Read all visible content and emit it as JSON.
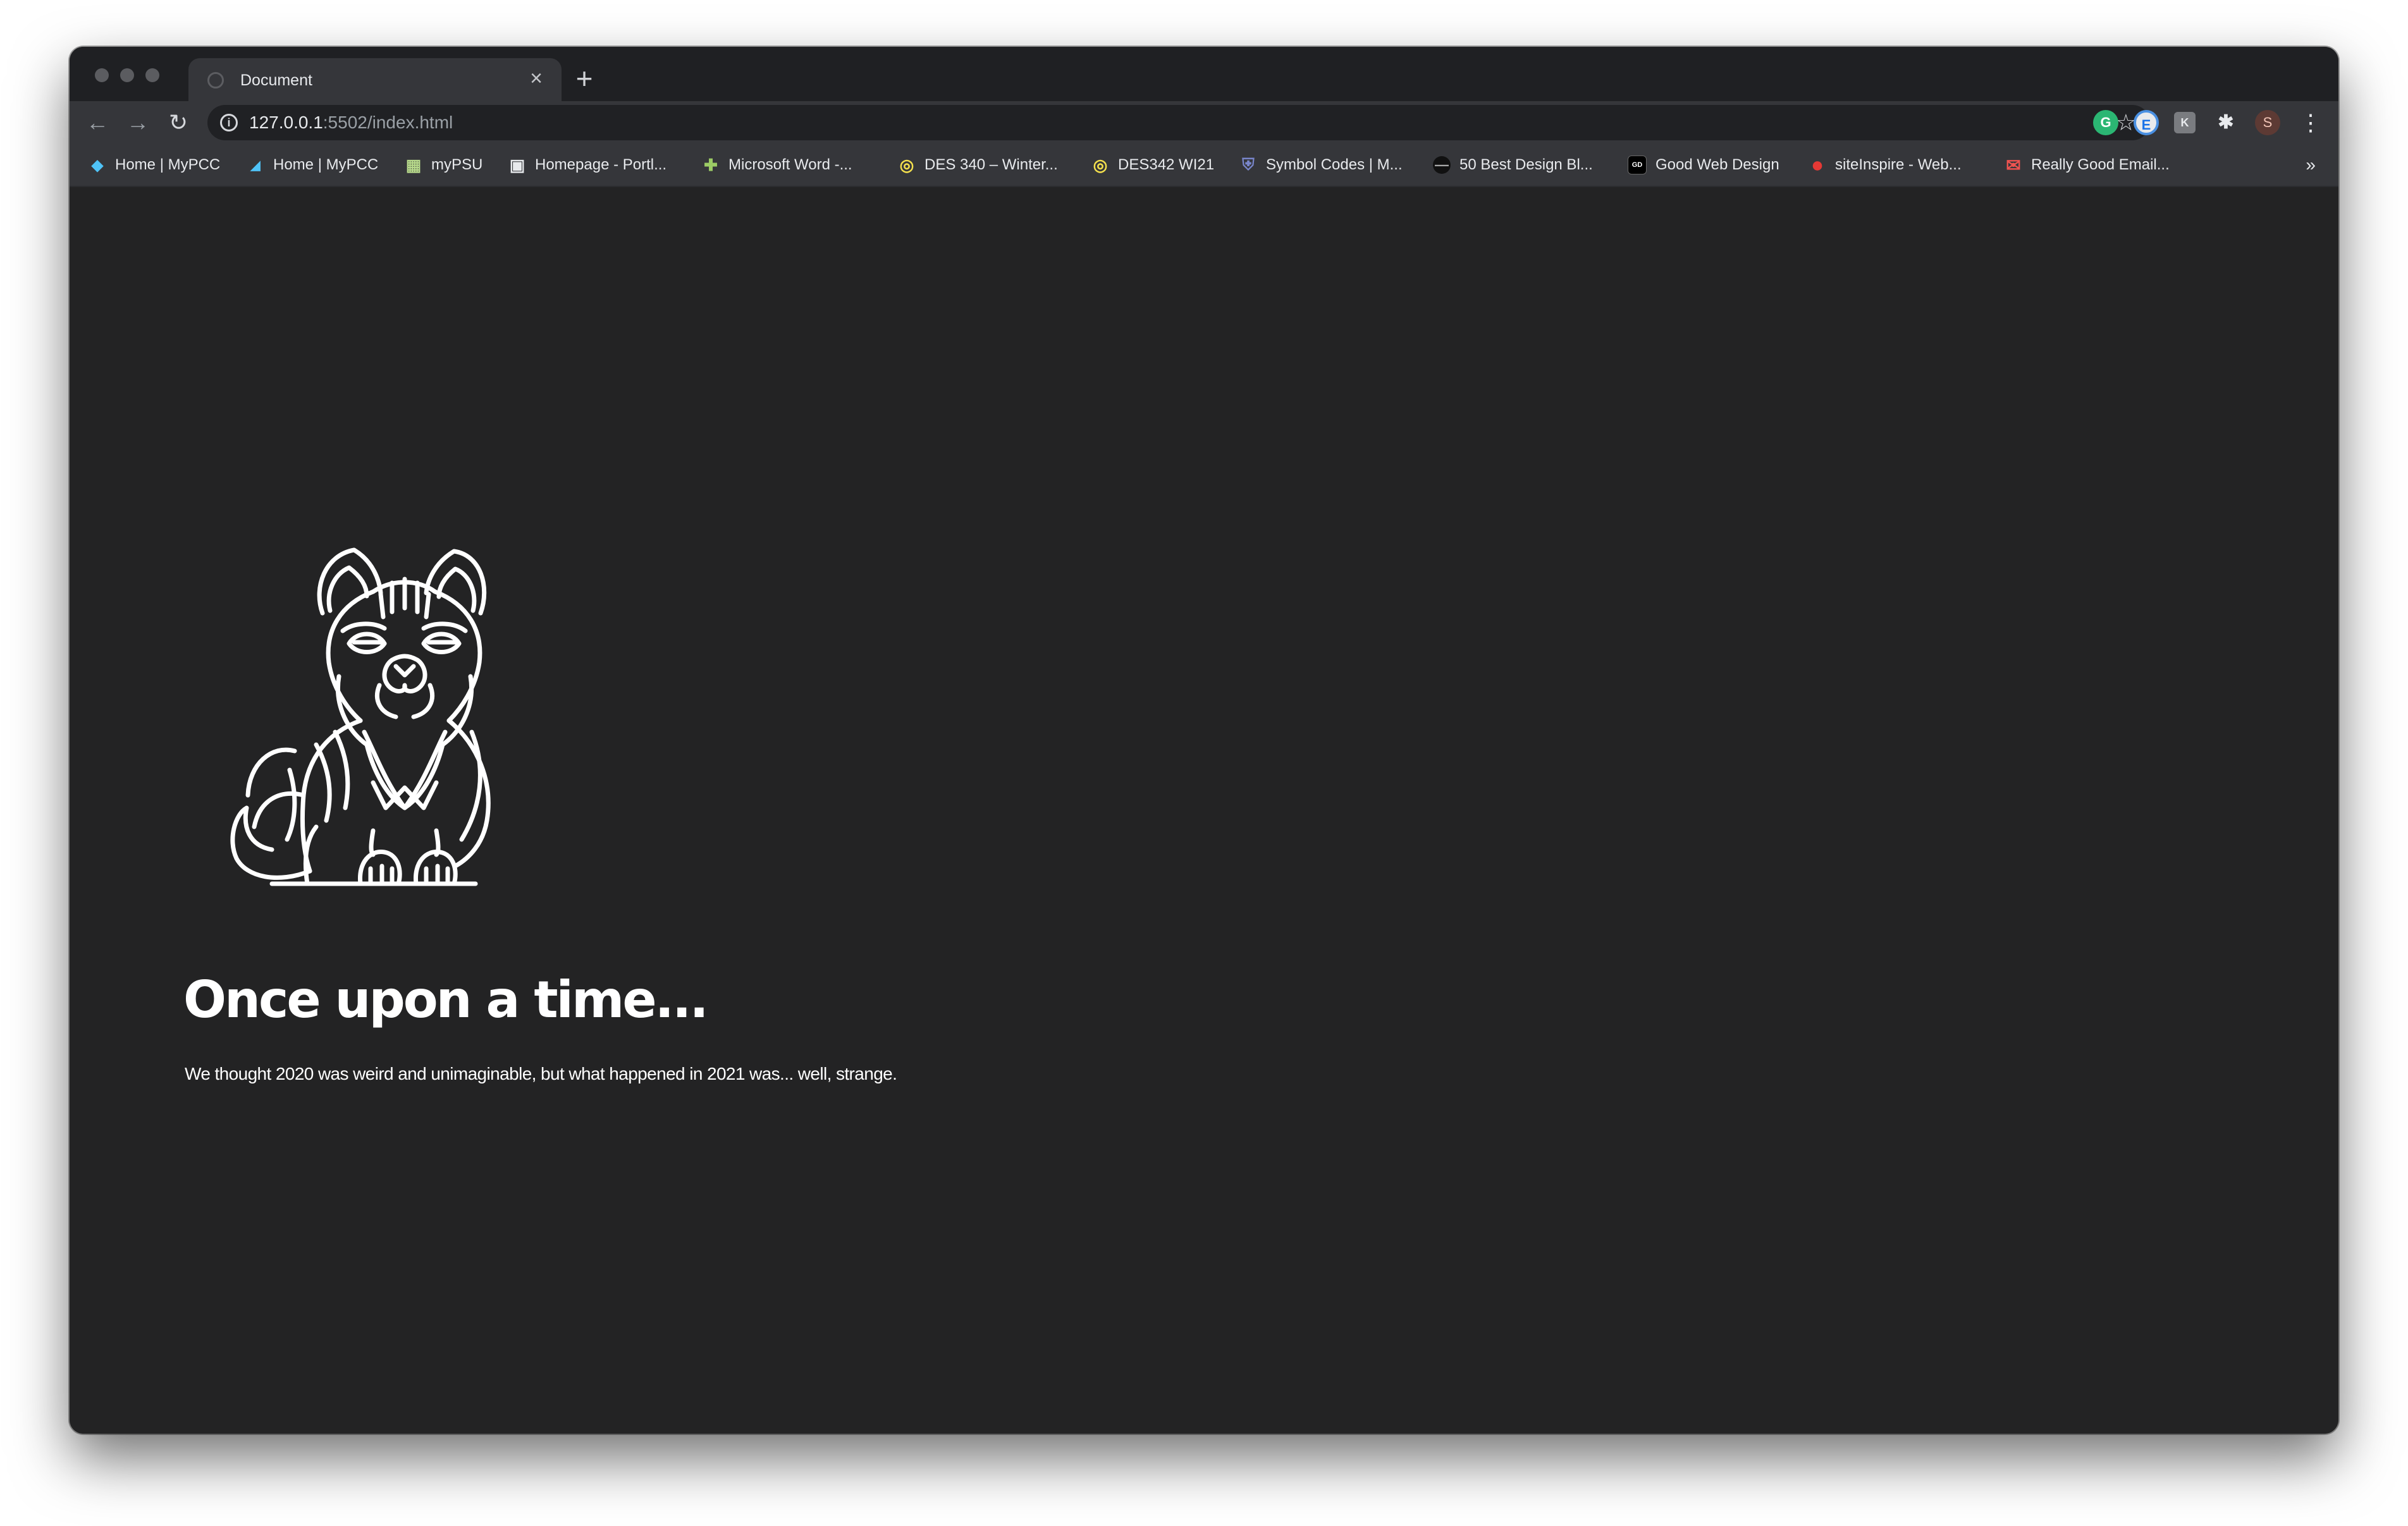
{
  "browser": {
    "tab": {
      "title": "Document",
      "close_glyph": "×"
    },
    "new_tab_glyph": "+",
    "toolbar": {
      "back_glyph": "←",
      "forward_glyph": "→",
      "reload_glyph": "↻",
      "url_host": "127.0.0.1",
      "url_rest": ":5502/index.html",
      "star_glyph": "☆",
      "extensions": [
        {
          "name": "grammarly-icon",
          "glyph": "G"
        },
        {
          "name": "extension-e-icon",
          "glyph": "E"
        },
        {
          "name": "extension-k-icon",
          "glyph": "K"
        },
        {
          "name": "puzzle-icon",
          "glyph": "✱"
        },
        {
          "name": "profile-avatar",
          "glyph": "S"
        }
      ],
      "menu_glyph": "⋮"
    },
    "bookmarks": [
      {
        "label": "Home | MyPCC",
        "icon": "mypcc-diamond-icon",
        "glyph": "◆",
        "color": "#4fc3f7"
      },
      {
        "label": "Home | MyPCC",
        "icon": "mypcc-flag-icon",
        "glyph": "◢",
        "color": "#4fc3f7"
      },
      {
        "label": "myPSU",
        "icon": "mypsu-icon",
        "glyph": "▦",
        "color": "#b7d98b"
      },
      {
        "label": "Homepage - Portl...",
        "icon": "portland-icon",
        "glyph": "▣",
        "color": "#e8eaed"
      },
      {
        "label": "Microsoft Word -...",
        "icon": "word-plus-icon",
        "glyph": "✚",
        "color": "#9ccc65"
      },
      {
        "label": "DES 340 – Winter...",
        "icon": "d2l-icon",
        "glyph": "◎",
        "color": "#f4e04d"
      },
      {
        "label": "DES342 WI21",
        "icon": "d2l-icon",
        "glyph": "◎",
        "color": "#f4e04d"
      },
      {
        "label": "Symbol Codes | M...",
        "icon": "shield-icon",
        "glyph": "⛨",
        "color": "#7986cb"
      },
      {
        "label": "50 Best Design Bl...",
        "icon": "design-blog-icon",
        "glyph": "—",
        "color": "#888888"
      },
      {
        "label": "Good Web Design",
        "icon": "gd-icon",
        "glyph": "GD",
        "color": "#000000"
      },
      {
        "label": "siteInspire - Web...",
        "icon": "siteinspire-icon",
        "glyph": "●",
        "color": "#e53935"
      },
      {
        "label": "Really Good Email...",
        "icon": "email-icon",
        "glyph": "✉",
        "color": "#ef5350"
      }
    ],
    "more_bookmarks_glyph": "»"
  },
  "page": {
    "heading": "Once upon a time...",
    "body": "We thought 2020 was weird and unimaginable, but what happened in 2021 was... well, strange."
  }
}
